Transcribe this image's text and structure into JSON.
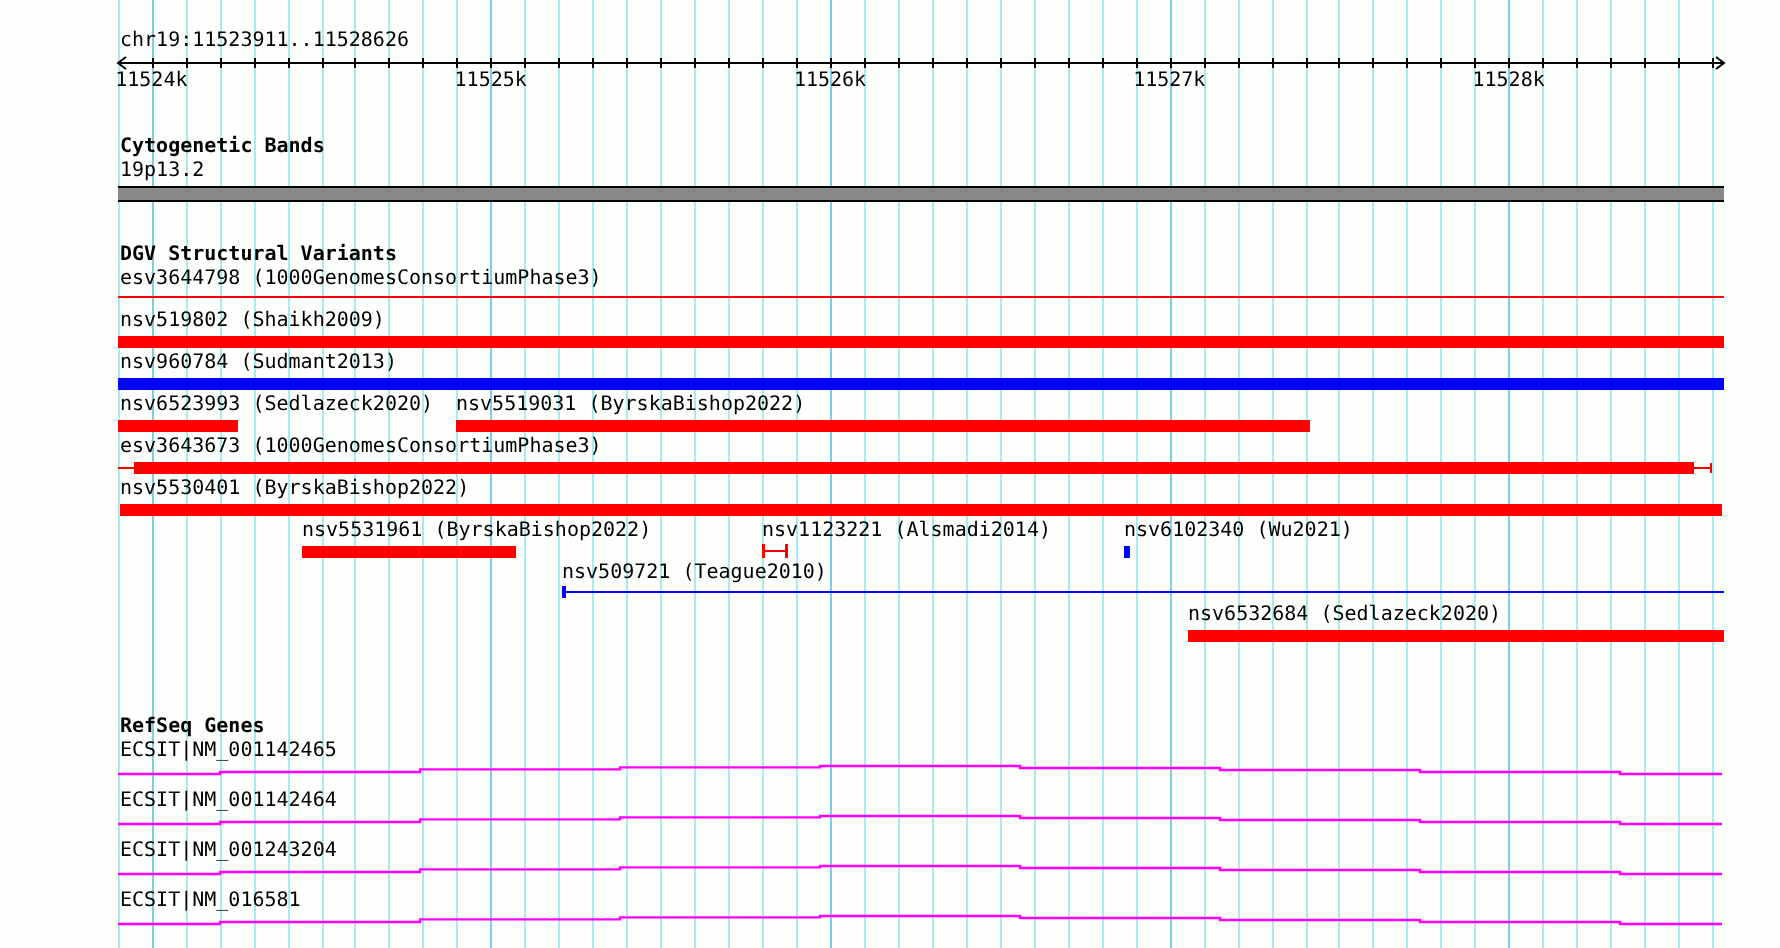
{
  "locus": "chr19:11523911..11528626",
  "ruler": {
    "ticks": [
      "11524k",
      "11525k",
      "11526k",
      "11527k",
      "11528k"
    ]
  },
  "tracks": [
    {
      "title": "Cytogenetic Bands",
      "features": [
        {
          "label": "19p13.2",
          "kind": "band"
        }
      ]
    },
    {
      "title": "DGV Structural Variants",
      "features": [
        {
          "label": "esv3644798 (1000GenomesConsortiumPhase3)",
          "kind": "thin",
          "color": "#ff0000"
        },
        {
          "label": "nsv519802 (Shaikh2009)",
          "kind": "thick",
          "color": "#ff0000"
        },
        {
          "label": "nsv960784 (Sudmant2013)",
          "kind": "thick",
          "color": "#0000ff"
        },
        {
          "label": "nsv6523993 (Sedlazeck2020)",
          "kind": "thick",
          "color": "#ff0000"
        },
        {
          "label": "nsv5519031 (ByrskaBishop2022)",
          "kind": "thick",
          "color": "#ff0000"
        },
        {
          "label": "esv3643673 (1000GenomesConsortiumPhase3)",
          "kind": "thick",
          "color": "#ff0000"
        },
        {
          "label": "nsv5530401 (ByrskaBishop2022)",
          "kind": "thick",
          "color": "#ff0000"
        },
        {
          "label": "nsv5531961 (ByrskaBishop2022)",
          "kind": "thick",
          "color": "#ff0000"
        },
        {
          "label": "nsv1123221 (Alsmadi2014)",
          "kind": "capped",
          "color": "#ff0000"
        },
        {
          "label": "nsv6102340 (Wu2021)",
          "kind": "thick",
          "color": "#0000ff"
        },
        {
          "label": "nsv509721 (Teague2010)",
          "kind": "thin",
          "color": "#0000ff"
        },
        {
          "label": "nsv6532684 (Sedlazeck2020)",
          "kind": "thick",
          "color": "#ff0000"
        }
      ]
    },
    {
      "title": "RefSeq Genes",
      "features": [
        {
          "label": "ECSIT|NM_001142465",
          "kind": "gene"
        },
        {
          "label": "ECSIT|NM_001142464",
          "kind": "gene"
        },
        {
          "label": "ECSIT|NM_001243204",
          "kind": "gene"
        },
        {
          "label": "ECSIT|NM_016581",
          "kind": "gene"
        }
      ]
    }
  ]
}
